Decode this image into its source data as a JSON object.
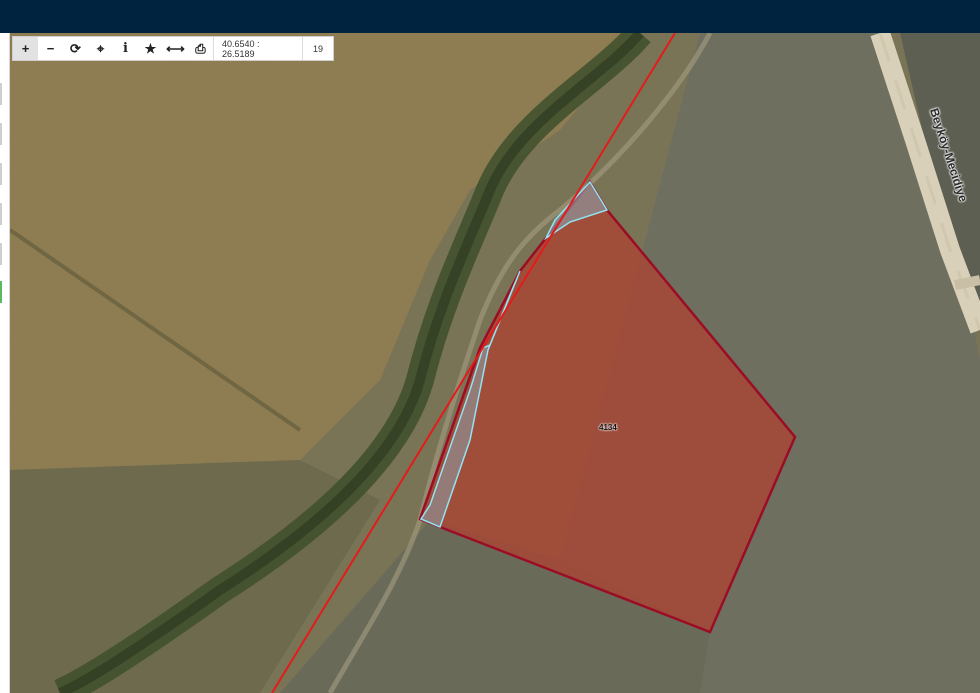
{
  "toolbar": {
    "buttons": [
      {
        "name": "zoom-in-icon",
        "glyph": "+"
      },
      {
        "name": "zoom-out-icon",
        "glyph": "−"
      },
      {
        "name": "refresh-icon",
        "glyph": "⟳"
      },
      {
        "name": "locate-icon",
        "glyph": "⌖"
      },
      {
        "name": "info-icon",
        "glyph": "i"
      },
      {
        "name": "star-icon",
        "glyph": "★"
      },
      {
        "name": "measure-icon",
        "glyph": "⟷"
      },
      {
        "name": "print-icon",
        "glyph": "⎙"
      }
    ],
    "coordinates": "40.6540 : 26.5189",
    "zoom": "19"
  },
  "map": {
    "road_label": "Beyköy-Mecidiye",
    "parcel_label": "4134",
    "colors": {
      "parcel_fill": "#a84535",
      "parcel_border": "#9b0d25",
      "boundary_line": "#e31b1b",
      "strip_outline": "#8fe4f3",
      "topbar": "#002340"
    }
  }
}
